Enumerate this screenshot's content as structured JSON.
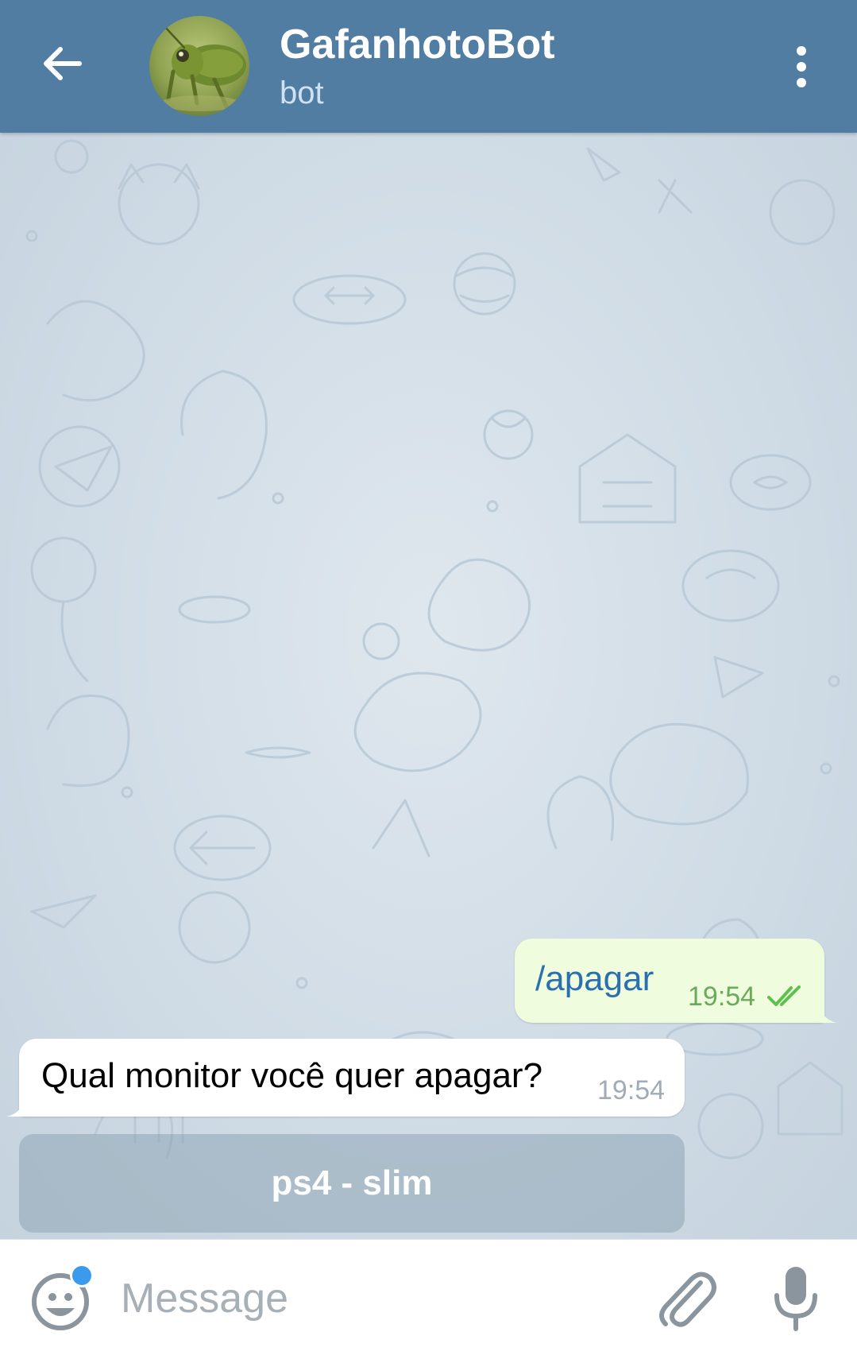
{
  "header": {
    "title": "GafanhotoBot",
    "subtitle": "bot",
    "back_icon": "arrow-left-icon",
    "menu_icon": "more-vertical-icon",
    "avatar_icon": "grasshopper-photo"
  },
  "messages": [
    {
      "direction": "outgoing",
      "text": "/apagar",
      "time": "19:54",
      "status": "read",
      "status_icon": "double-check-icon"
    },
    {
      "direction": "incoming",
      "text": "Qual monitor você quer apagar?",
      "time": "19:54"
    }
  ],
  "inline_keyboard": {
    "buttons": [
      {
        "label": "ps4 - slim"
      }
    ]
  },
  "composer": {
    "placeholder": "Message",
    "emoji_icon": "emoji-smile-icon",
    "attach_icon": "paperclip-icon",
    "mic_icon": "microphone-icon"
  },
  "colors": {
    "header_bg": "#517da2",
    "outgoing_bubble": "#effdde",
    "incoming_bubble": "#ffffff",
    "link_text": "#2b6fb0",
    "outgoing_time": "#6aaa5a",
    "notification_dot": "#3a9bed"
  }
}
